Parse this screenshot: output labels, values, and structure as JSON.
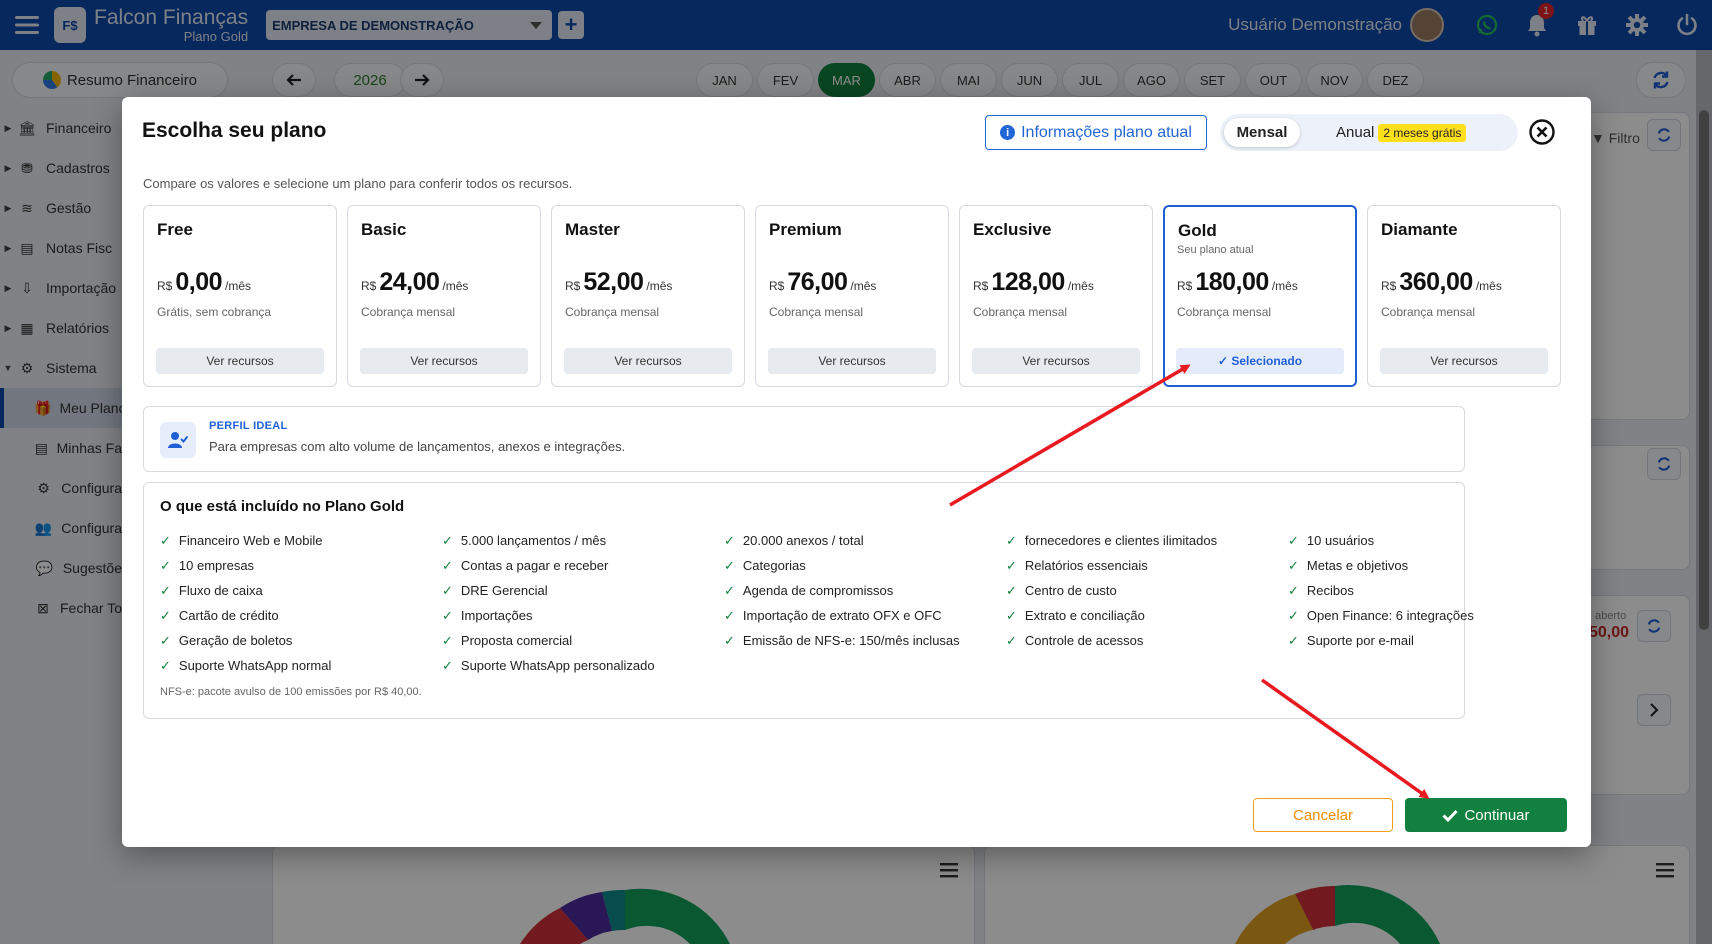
{
  "header": {
    "brand_name": "Falcon Finanças",
    "brand_plan": "Plano Gold",
    "logo_text": "F$",
    "company": "EMPRESA DE DEMONSTRAÇÃO",
    "user_name": "Usuário Demonstração",
    "notification_count": "1",
    "icons": [
      "menu-icon",
      "whatsapp-icon",
      "bell-icon",
      "gift-icon",
      "gear-icon",
      "power-icon"
    ]
  },
  "toolbar": {
    "resumo_label": "Resumo Financeiro",
    "year": "2026",
    "months": [
      "JAN",
      "FEV",
      "MAR",
      "ABR",
      "MAI",
      "JUN",
      "JUL",
      "AGO",
      "SET",
      "OUT",
      "NOV",
      "DEZ"
    ],
    "active_month": "MAR"
  },
  "sidebar": {
    "items": [
      {
        "label": "Financeiro",
        "icon": "bank-icon"
      },
      {
        "label": "Cadastros",
        "icon": "coins-icon"
      },
      {
        "label": "Gestão",
        "icon": "layers-icon"
      },
      {
        "label": "Notas Fisc",
        "icon": "document-icon"
      },
      {
        "label": "Importação",
        "icon": "import-icon"
      },
      {
        "label": "Relatórios",
        "icon": "report-icon"
      },
      {
        "label": "Sistema",
        "icon": "cogs-icon"
      }
    ],
    "sub_items": [
      {
        "label": "Meu Plano",
        "icon": "gift-icon"
      },
      {
        "label": "Minhas Fa",
        "icon": "invoice-icon"
      },
      {
        "label": "Configura",
        "icon": "gear-icon"
      },
      {
        "label": "Configura",
        "icon": "users-gear-icon"
      },
      {
        "label": "Sugestõe",
        "icon": "chat-icon"
      },
      {
        "label": "Fechar To",
        "icon": "close-box-icon"
      }
    ]
  },
  "background": {
    "filtro_label": "Filtro",
    "aberto_label": "aberto",
    "value_partial": "50,00"
  },
  "modal": {
    "title": "Escolha seu plano",
    "info_button": "Informações plano atual",
    "billing": {
      "monthly": "Mensal",
      "annual": "Anual",
      "promo": "2 meses grátis",
      "selected": "Mensal"
    },
    "subtitle": "Compare os valores e selecione um plano para conferir todos os recursos.",
    "currency": "R$",
    "period": "/mês",
    "plans": [
      {
        "name": "Free",
        "price": "0,00",
        "note": "Grátis, sem cobrança",
        "button": "Ver recursos"
      },
      {
        "name": "Basic",
        "price": "24,00",
        "note": "Cobrança mensal",
        "button": "Ver recursos"
      },
      {
        "name": "Master",
        "price": "52,00",
        "note": "Cobrança mensal",
        "button": "Ver recursos"
      },
      {
        "name": "Premium",
        "price": "76,00",
        "note": "Cobrança mensal",
        "button": "Ver recursos"
      },
      {
        "name": "Exclusive",
        "price": "128,00",
        "note": "Cobrança mensal",
        "button": "Ver recursos"
      },
      {
        "name": "Gold",
        "price": "180,00",
        "note": "Cobrança mensal",
        "button": "✓ Selecionado",
        "current_label": "Seu plano atual",
        "selected": true
      },
      {
        "name": "Diamante",
        "price": "360,00",
        "note": "Cobrança mensal",
        "button": "Ver recursos"
      }
    ],
    "ideal": {
      "label": "PERFIL IDEAL",
      "description": "Para empresas com alto volume de lançamentos, anexos e integrações."
    },
    "included": {
      "title": "O que está incluído no Plano Gold",
      "items": [
        "Financeiro Web e Mobile",
        "5.000 lançamentos / mês",
        "20.000 anexos / total",
        "fornecedores e clientes ilimitados",
        "10 usuários",
        "10 empresas",
        "Contas a pagar e receber",
        "Categorias",
        "Relatórios essenciais",
        "Metas e objetivos",
        "Fluxo de caixa",
        "DRE Gerencial",
        "Agenda de compromissos",
        "Centro de custo",
        "Recibos",
        "Cartão de crédito",
        "Importações",
        "Importação de extrato OFX e OFC",
        "Extrato e conciliação",
        "Open Finance: 6 integrações",
        "Geração de boletos",
        "Proposta comercial",
        "Emissão de NFS-e: 150/mês inclusas",
        "Controle de acessos",
        "Suporte por e-mail",
        "Suporte WhatsApp normal",
        "Suporte WhatsApp personalizado"
      ],
      "footnote": "NFS-e: pacote avulso de 100 emissões por R$ 40,00."
    },
    "cancel_button": "Cancelar",
    "continue_button": "Continuar"
  },
  "colors": {
    "header_bg": "#0c4aa8",
    "accent_green": "#12803f",
    "selected_blue": "#1f5fd6",
    "promo_yellow": "#ffe01b",
    "cancel_orange": "#f08c00",
    "annotation_red": "#e8191f"
  }
}
